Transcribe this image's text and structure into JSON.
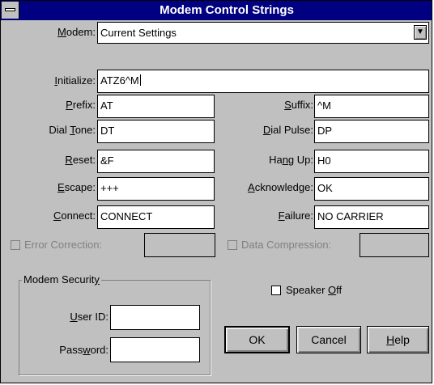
{
  "window": {
    "title": "Modem Control Strings"
  },
  "icons": {
    "system_menu": "system-menu-icon",
    "dropdown": "dropdown-arrow-icon"
  },
  "modem": {
    "label": "Modem:",
    "value": "Current Settings"
  },
  "initialize": {
    "label": "Initialize:",
    "value": "ATZ6^M"
  },
  "left_fields": [
    {
      "label": "Prefix:",
      "value": "AT"
    },
    {
      "label": "Dial Tone:",
      "value": "DT"
    },
    {
      "label": "Reset:",
      "value": "&F"
    },
    {
      "label": "Escape:",
      "value": "+++"
    },
    {
      "label": "Connect:",
      "value": "CONNECT"
    }
  ],
  "right_fields": [
    {
      "label": "Suffix:",
      "value": "^M"
    },
    {
      "label": "Dial Pulse:",
      "value": "DP"
    },
    {
      "label": "Hang Up:",
      "value": "H0"
    },
    {
      "label": "Acknowledge:",
      "value": "OK"
    },
    {
      "label": "Failure:",
      "value": "NO CARRIER"
    }
  ],
  "error_correction": {
    "label": "Error Correction:",
    "checked": false,
    "enabled": false,
    "value": ""
  },
  "data_compression": {
    "label": "Data Compression:",
    "checked": false,
    "enabled": false,
    "value": ""
  },
  "security": {
    "title": "Modem Security",
    "user_id_label": "User ID:",
    "user_id_value": "",
    "password_label": "Password:",
    "password_value": ""
  },
  "speaker_off": {
    "label": "Speaker Off",
    "checked": false
  },
  "buttons": {
    "ok": "OK",
    "cancel": "Cancel",
    "help": "Help"
  }
}
